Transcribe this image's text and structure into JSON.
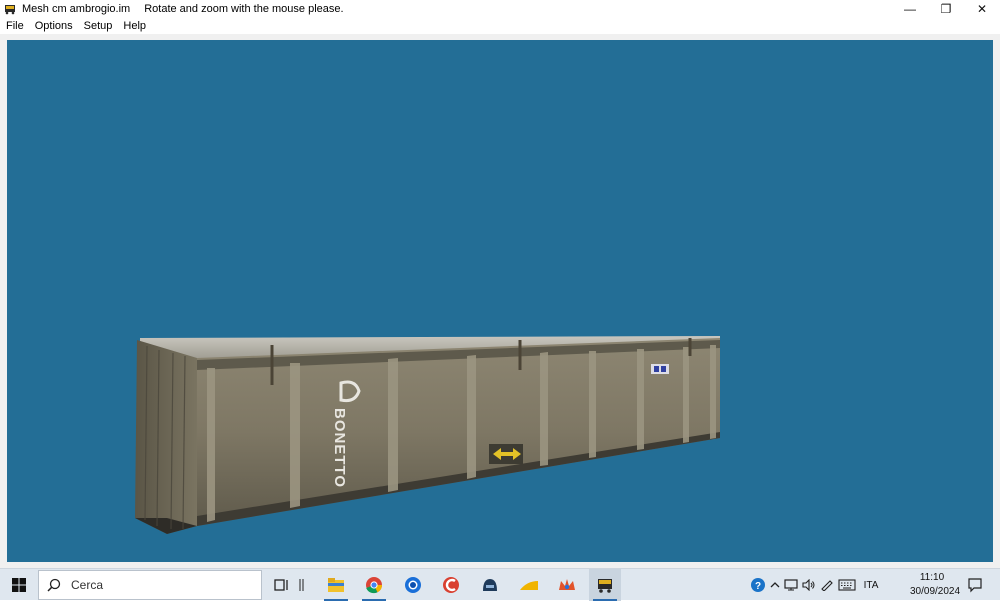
{
  "window": {
    "title": "Mesh cm ambrogio.im",
    "hint": "Rotate and zoom with the mouse please.",
    "controls": {
      "minimize": "—",
      "restore": "❐",
      "close": "✕"
    }
  },
  "menu": {
    "items": [
      "File",
      "Options",
      "Setup",
      "Help"
    ]
  },
  "viewport": {
    "background": "#236e96",
    "container_text": "BONETTO"
  },
  "taskbar": {
    "search_placeholder": "Cerca",
    "language": "ITA",
    "time": "11:10",
    "date": "30/09/2024"
  }
}
